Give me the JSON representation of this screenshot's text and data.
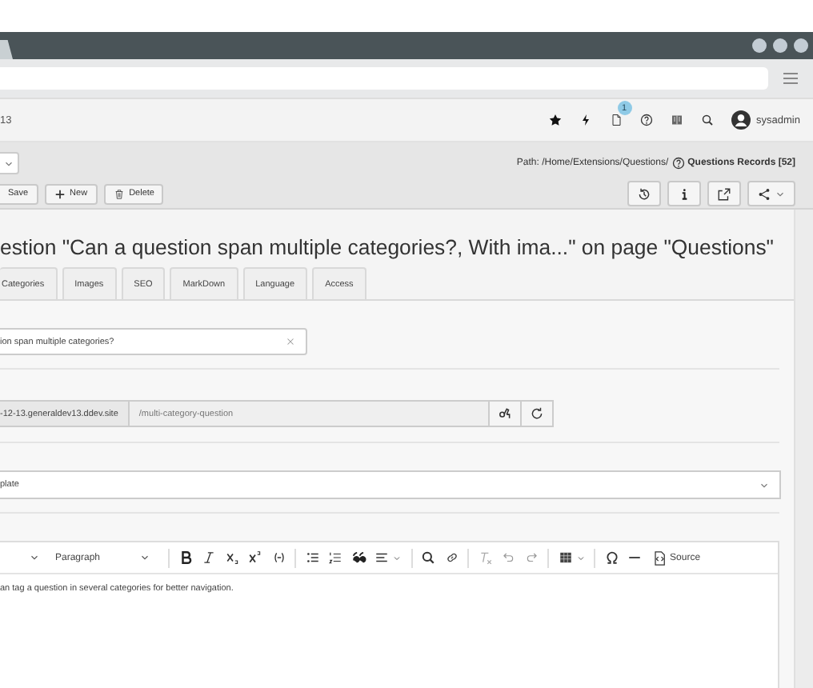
{
  "module_header": {
    "site_label": "13",
    "notification_badge": "1",
    "username": "sysadmin"
  },
  "doc_header": {
    "path": "Path: /Home/Extensions/Questions/",
    "record_title": "Questions Records [52]",
    "buttons": [
      {
        "kind": "save",
        "label": "Save"
      },
      {
        "kind": "new",
        "label": "New"
      },
      {
        "kind": "delete",
        "label": "Delete"
      }
    ],
    "view_buttons": [
      {
        "kind": "history"
      },
      {
        "kind": "info"
      },
      {
        "kind": "open"
      },
      {
        "kind": "share"
      }
    ]
  },
  "title": "estion \"Can a question span multiple categories?, With ima...\" on page \"Questions\"",
  "tabs": [
    {
      "label": "Categories",
      "selected": false
    },
    {
      "label": "Images",
      "selected": false
    },
    {
      "label": "SEO",
      "selected": false
    },
    {
      "label": "MarkDown",
      "selected": false
    },
    {
      "label": "Language",
      "selected": false
    },
    {
      "label": "Access",
      "selected": false
    }
  ],
  "form": {
    "question_field": {
      "value": "ion span multiple categories?"
    },
    "slug": {
      "prefix": "-12-13.generaldev13.ddev.site",
      "value": "/multi-category-question"
    },
    "template_select": {
      "value": "plate"
    },
    "editor": {
      "toolbar": [
        {
          "kind": "caret"
        },
        {
          "kind": "dropdown",
          "label": "Paragraph"
        },
        {
          "kind": "separator"
        },
        {
          "kind": "bold"
        },
        {
          "kind": "italic"
        },
        {
          "kind": "subscript"
        },
        {
          "kind": "superscript"
        },
        {
          "kind": "code"
        },
        {
          "kind": "separator"
        },
        {
          "kind": "bulleted-list"
        },
        {
          "kind": "numbered-list"
        },
        {
          "kind": "quote"
        },
        {
          "kind": "align"
        },
        {
          "kind": "separator"
        },
        {
          "kind": "find"
        },
        {
          "kind": "link"
        },
        {
          "kind": "separator"
        },
        {
          "kind": "clear-format"
        },
        {
          "kind": "undo"
        },
        {
          "kind": "redo"
        },
        {
          "kind": "separator"
        },
        {
          "kind": "table"
        },
        {
          "kind": "separator"
        },
        {
          "kind": "special-char"
        },
        {
          "kind": "horizontal-line"
        },
        {
          "kind": "source",
          "label": "Source"
        }
      ],
      "content": "an tag a question in several categories for better navigation."
    }
  }
}
